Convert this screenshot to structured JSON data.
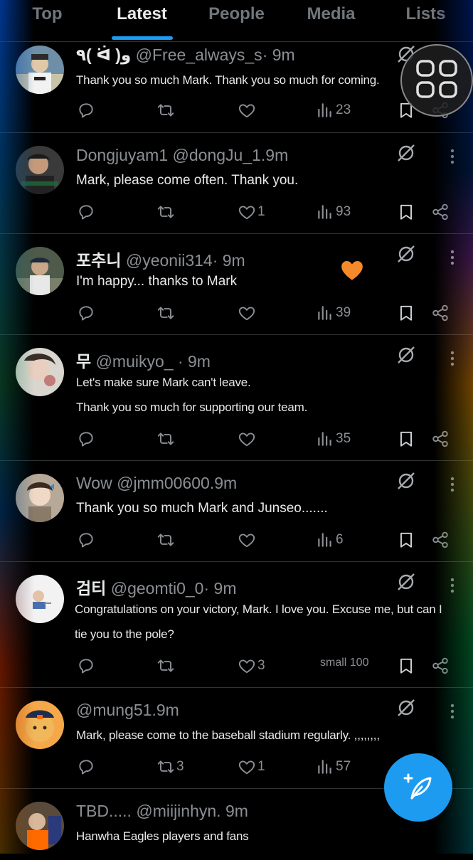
{
  "tabs": [
    {
      "label": "Top",
      "active": false
    },
    {
      "label": "Latest",
      "active": true
    },
    {
      "label": "People",
      "active": false
    },
    {
      "label": "Media",
      "active": false
    },
    {
      "label": "Lists",
      "active": false
    }
  ],
  "tweets": [
    {
      "name": "٩( ᐛ )و",
      "handle": "@Free_always_s",
      "time": "· 9m",
      "text": [
        "Thank you so much Mark. Thank you so much for coming."
      ],
      "replies": "",
      "retweets": "",
      "likes": "",
      "views": "23"
    },
    {
      "name": "Dongjuyam1",
      "handle": "@dongJu_1",
      "time": ".9m",
      "text": [
        "Mark, please come often. Thank you."
      ],
      "replies": "",
      "retweets": "",
      "likes": "1",
      "views": "93"
    },
    {
      "name": "포추니",
      "handle": "@yeonii314",
      "time": "· 9m",
      "text": [
        "I'm happy... thanks to Mark"
      ],
      "replies": "",
      "retweets": "",
      "likes": "",
      "views": "39"
    },
    {
      "name": "무",
      "handle": "@muikyo_",
      "time": " · 9m",
      "text": [
        "Let's make sure Mark can't leave.",
        "Thank you so much for supporting our team."
      ],
      "replies": "",
      "retweets": "",
      "likes": "",
      "views": "35"
    },
    {
      "name": "Wow",
      "handle": "@jmm00600",
      "time": ".9m",
      "text": [
        "Thank you so much Mark and Junseo......."
      ],
      "replies": "",
      "retweets": "",
      "likes": "",
      "views": "6"
    },
    {
      "name": "검티",
      "handle": "@geomti0_0",
      "time": "· 9m",
      "text": [
        "Congratulations on your victory, Mark. I love you. Excuse me, but can I",
        "tie you to the pole?"
      ],
      "replies": "",
      "retweets": "",
      "likes": "3",
      "views": "small 100"
    },
    {
      "name": "",
      "handle": "@mung51",
      "time": ".9m",
      "text": [
        "Mark, please come to the baseball stadium regularly. ,,,,,,,,"
      ],
      "replies": "",
      "retweets": "3",
      "likes": "1",
      "views": "57"
    },
    {
      "name": "TBD.....",
      "handle": "@miijinhyn",
      "time": ". 9m",
      "text": [
        "Hanwha Eagles players and fans"
      ],
      "replies": "",
      "retweets": "",
      "likes": "",
      "views": ""
    }
  ],
  "colors": {
    "accent": "#1d9bf0",
    "background": "#000000",
    "muted": "#71767b",
    "heart_emoji": "#f58a2b"
  },
  "icons": [
    "reply-icon",
    "retweet-icon",
    "like-icon",
    "views-icon",
    "bookmark-icon",
    "share-icon",
    "grok-icon",
    "more-icon",
    "compose-feather-icon",
    "heart-emoji",
    "app-switcher-icon"
  ]
}
